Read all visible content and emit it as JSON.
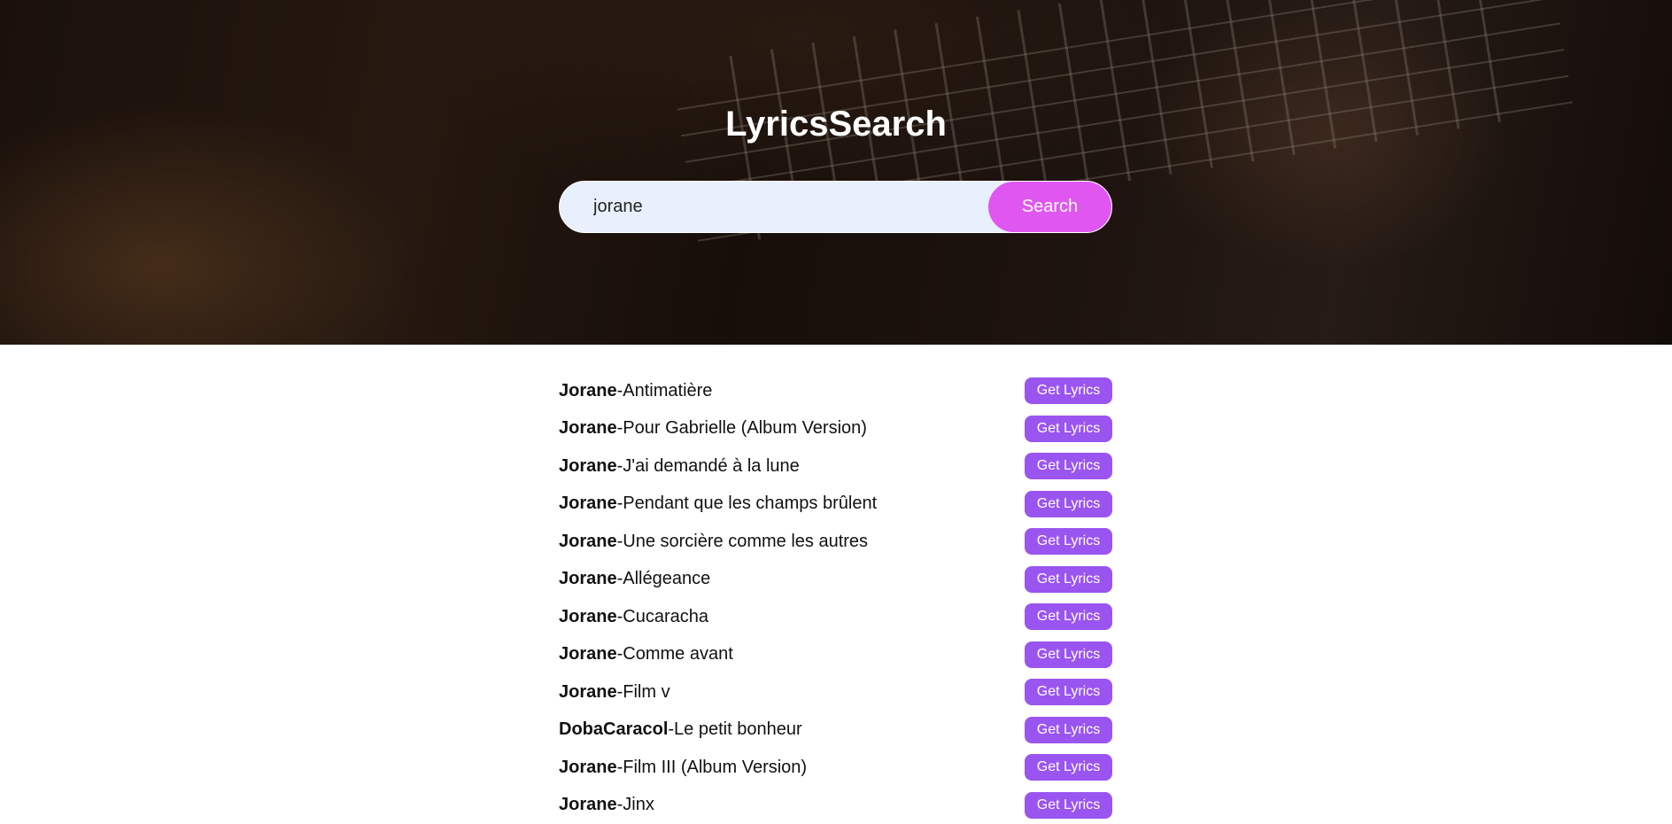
{
  "header": {
    "title": "LyricsSearch"
  },
  "search": {
    "value": "jorane",
    "button_label": "Search"
  },
  "results": [
    {
      "artist": "Jorane",
      "separator": "-",
      "song": "Antimatière",
      "button_label": "Get Lyrics"
    },
    {
      "artist": "Jorane",
      "separator": "-",
      "song": "Pour Gabrielle (Album Version)",
      "button_label": "Get Lyrics"
    },
    {
      "artist": "Jorane",
      "separator": "-",
      "song": "J'ai demandé à la lune",
      "button_label": "Get Lyrics"
    },
    {
      "artist": "Jorane",
      "separator": "-",
      "song": "Pendant que les champs brûlent",
      "button_label": "Get Lyrics"
    },
    {
      "artist": "Jorane",
      "separator": "-",
      "song": "Une sorcière comme les autres",
      "button_label": "Get Lyrics"
    },
    {
      "artist": "Jorane",
      "separator": "-",
      "song": "Allégeance",
      "button_label": "Get Lyrics"
    },
    {
      "artist": "Jorane",
      "separator": "-",
      "song": "Cucaracha",
      "button_label": "Get Lyrics"
    },
    {
      "artist": "Jorane",
      "separator": "-",
      "song": "Comme avant",
      "button_label": "Get Lyrics"
    },
    {
      "artist": "Jorane",
      "separator": "-",
      "song": "Film v",
      "button_label": "Get Lyrics"
    },
    {
      "artist": "DobaCaracol",
      "separator": "-",
      "song": "Le petit bonheur",
      "button_label": "Get Lyrics"
    },
    {
      "artist": "Jorane",
      "separator": "-",
      "song": "Film III (Album Version)",
      "button_label": "Get Lyrics"
    },
    {
      "artist": "Jorane",
      "separator": "-",
      "song": "Jinx",
      "button_label": "Get Lyrics"
    }
  ],
  "colors": {
    "search_button": "#e056f0",
    "get_lyrics_button": "#9a55f0",
    "search_field_bg": "#e8f0fe"
  }
}
